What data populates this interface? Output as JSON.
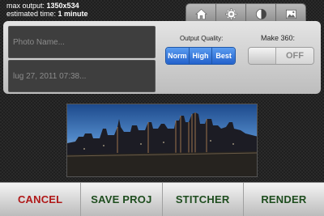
{
  "info": {
    "max_output_label": "max output: ",
    "max_output_value": "1350x534",
    "estimated_time_label": "estimated time: ",
    "estimated_time_value": "1 minute"
  },
  "toolbar": {
    "tabs": [
      {
        "icon": "home-icon"
      },
      {
        "icon": "gear-icon"
      },
      {
        "icon": "contrast-icon"
      },
      {
        "icon": "image-icon"
      }
    ]
  },
  "settings": {
    "photo_name_placeholder": "Photo Name...",
    "date_value": "lug 27, 2011 07:38...",
    "output_quality_label": "Output Quality:",
    "quality_options": [
      "Norm",
      "High",
      "Best"
    ],
    "make360_label": "Make 360:",
    "make360_state": "OFF"
  },
  "bottom_bar": {
    "cancel": "CANCEL",
    "save_proj": "SAVE PROJ",
    "stitcher": "STITCHER",
    "render": "RENDER"
  },
  "colors": {
    "accent_blue": "#2f6fd8",
    "cancel_red": "#b01818",
    "action_green": "#1e4d1e"
  }
}
